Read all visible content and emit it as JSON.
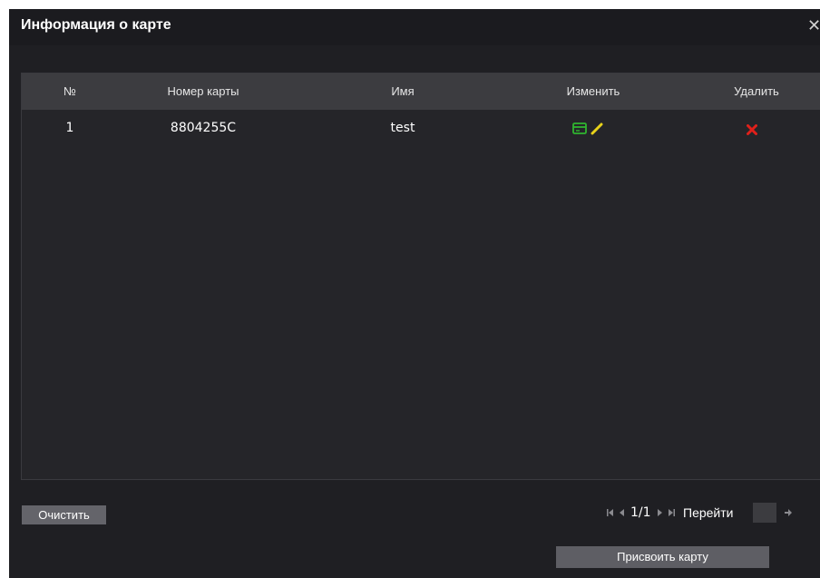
{
  "dialog": {
    "title": "Информация о карте",
    "close_glyph": "✕"
  },
  "table": {
    "headers": {
      "no": "№",
      "card_number": "Номер карты",
      "name": "Имя",
      "edit": "Изменить",
      "delete": "Удалить"
    },
    "rows": [
      {
        "no": "1",
        "card_number": "8804255C",
        "name": "test"
      }
    ]
  },
  "icons": {
    "card_edit": "card-icon",
    "pencil": "pencil-icon",
    "delete": "delete-x-icon"
  },
  "colors": {
    "card_icon": "#2fb52f",
    "pencil_icon": "#e8d21a",
    "delete_icon": "#e0201a"
  },
  "footer": {
    "clear_button": "Очистить",
    "pagination": {
      "page_text": "1/1",
      "goto_label": "Перейти",
      "goto_value": ""
    },
    "assign_button": "Присвоить карту"
  }
}
